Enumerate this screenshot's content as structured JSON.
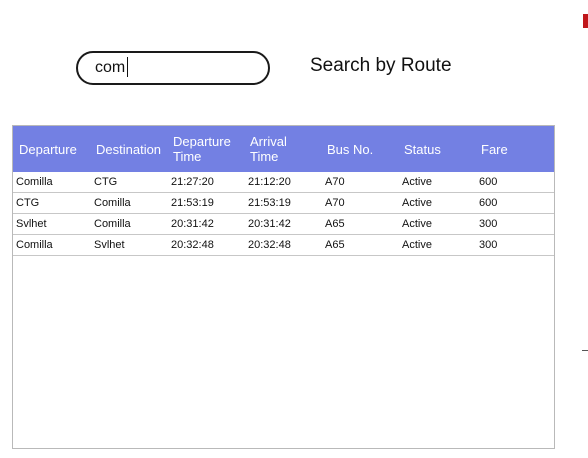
{
  "search": {
    "value": "com",
    "label": "Search by Route"
  },
  "table": {
    "headers": [
      "Departure",
      "Destination",
      "Departure\nTime",
      "Arrival\nTime",
      "Bus No.",
      "Status",
      "Fare"
    ],
    "rows": [
      [
        "Comilla",
        "CTG",
        "21:27:20",
        "21:12:20",
        "A70",
        "Active",
        "600"
      ],
      [
        "CTG",
        "Comilla",
        "21:53:19",
        "21:53:19",
        "A70",
        "Active",
        "600"
      ],
      [
        "Svlhet",
        "Comilla",
        "20:31:42",
        "20:31:42",
        "A65",
        "Active",
        "300"
      ],
      [
        "Comilla",
        "Svlhet",
        "20:32:48",
        "20:32:48",
        "A65",
        "Active",
        "300"
      ]
    ]
  },
  "colors": {
    "header_bg": "#7380e3",
    "header_text": "#ffffff",
    "accent_red": "#c0161a"
  }
}
